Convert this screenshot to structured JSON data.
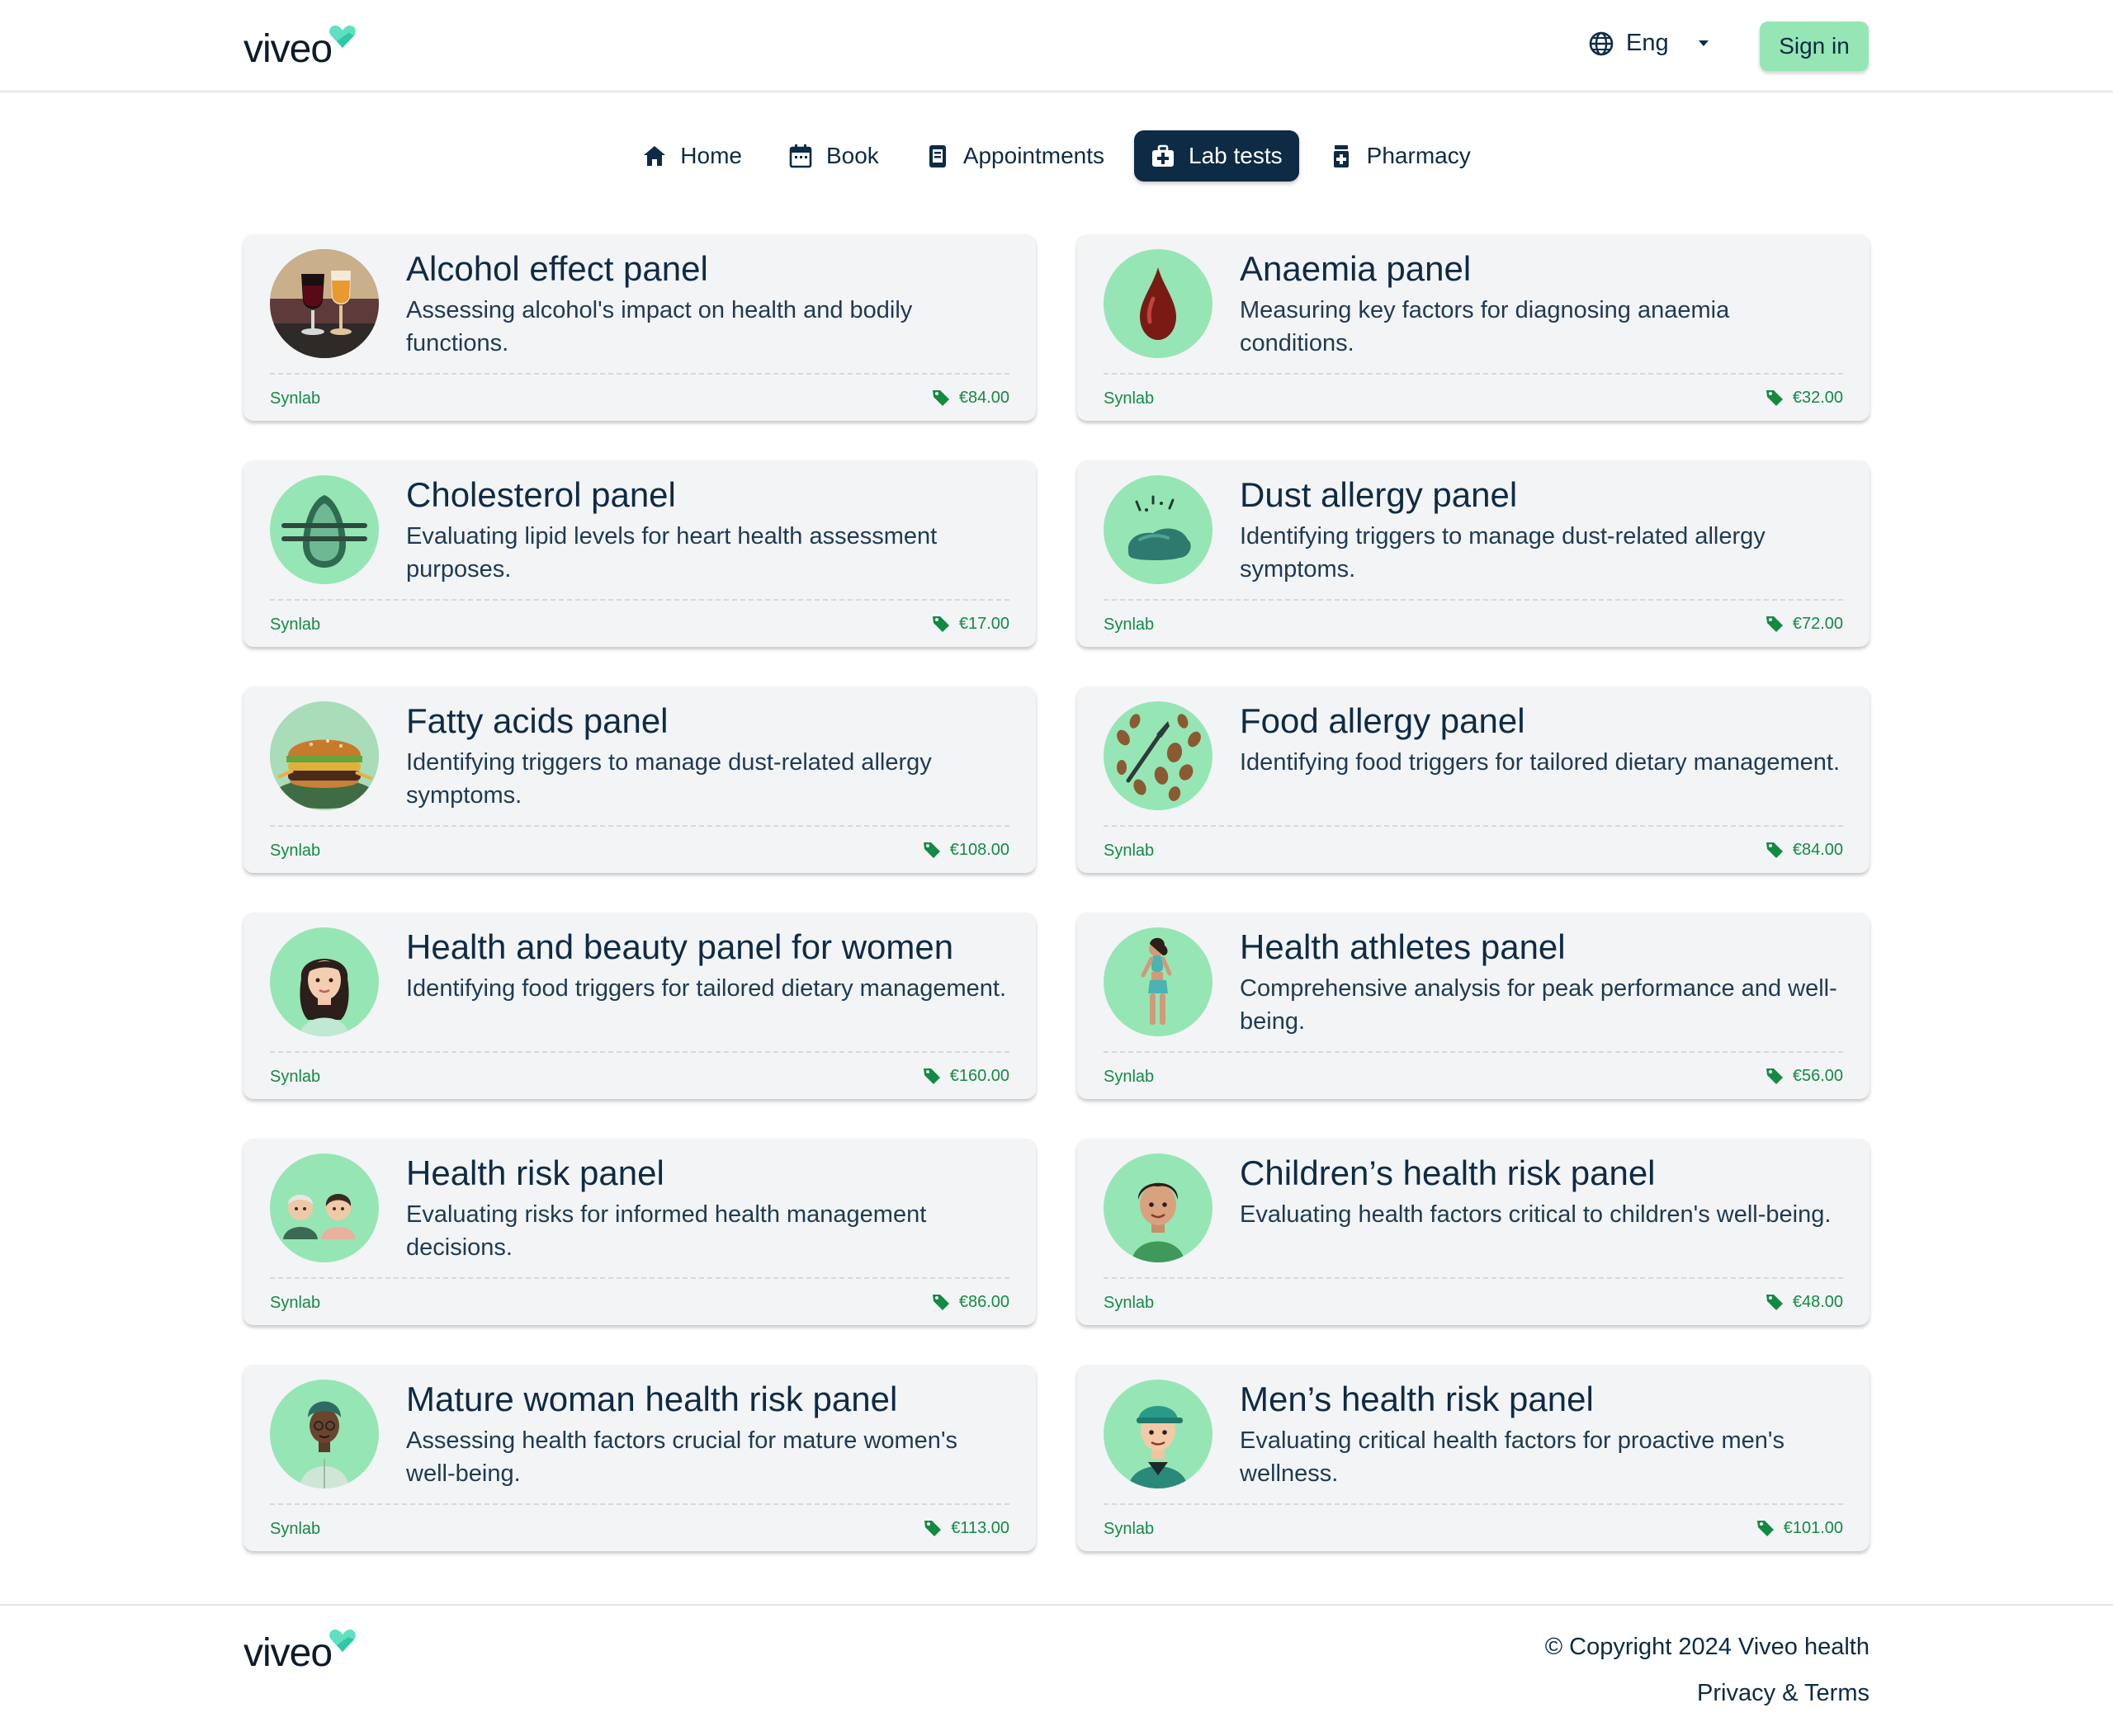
{
  "brand": {
    "name": "viveo",
    "accent": "#95e6b4",
    "navy": "#0e2b45",
    "green": "#138a44"
  },
  "header": {
    "language": "Eng",
    "sign_in": "Sign in"
  },
  "nav": {
    "items": [
      {
        "label": "Home",
        "icon": "home-icon"
      },
      {
        "label": "Book",
        "icon": "calendar-icon"
      },
      {
        "label": "Appointments",
        "icon": "clipboard-icon"
      },
      {
        "label": "Lab tests",
        "icon": "medical-kit-icon",
        "active": true
      },
      {
        "label": "Pharmacy",
        "icon": "pill-bottle-icon"
      }
    ]
  },
  "cards": [
    {
      "title": "Alcohol effect panel",
      "description": "Assessing alcohol's impact on health and bodily functions.",
      "provider": "Synlab",
      "price": "€84.00",
      "image": "wine-glasses-image"
    },
    {
      "title": "Anaemia panel",
      "description": "Measuring key factors for diagnosing anaemia conditions.",
      "provider": "Synlab",
      "price": "€32.00",
      "image": "blood-drop-image"
    },
    {
      "title": "Cholesterol panel",
      "description": "Evaluating lipid levels for heart health assessment purposes.",
      "provider": "Synlab",
      "price": "€17.00",
      "image": "avocado-image"
    },
    {
      "title": "Dust allergy panel",
      "description": "Identifying triggers to manage dust-related allergy symptoms.",
      "provider": "Synlab",
      "price": "€72.00",
      "image": "dust-pile-image"
    },
    {
      "title": "Fatty acids panel",
      "description": "Identifying triggers to manage dust-related allergy symptoms.",
      "provider": "Synlab",
      "price": "€108.00",
      "image": "burger-image"
    },
    {
      "title": "Food allergy panel",
      "description": "Identifying food triggers for tailored dietary management.",
      "provider": "Synlab",
      "price": "€84.00",
      "image": "nuts-image"
    },
    {
      "title": "Health and beauty panel for women",
      "description": "Identifying food triggers for tailored dietary management.",
      "provider": "Synlab",
      "price": "€160.00",
      "image": "woman-image"
    },
    {
      "title": "Health athletes panel",
      "description": "Comprehensive analysis for peak performance and well-being.",
      "provider": "Synlab",
      "price": "€56.00",
      "image": "athlete-image"
    },
    {
      "title": "Health risk panel",
      "description": "Evaluating risks for informed health management decisions.",
      "provider": "Synlab",
      "price": "€86.00",
      "image": "couple-image"
    },
    {
      "title": "Children’s health risk panel",
      "description": "Evaluating health factors critical to children's well-being.",
      "provider": "Synlab",
      "price": "€48.00",
      "image": "child-image"
    },
    {
      "title": "Mature woman health risk panel",
      "description": "Assessing health factors crucial for mature women's well-being.",
      "provider": "Synlab",
      "price": "€113.00",
      "image": "mature-woman-image"
    },
    {
      "title": "Men’s health risk panel",
      "description": "Evaluating critical health factors for proactive men's wellness.",
      "provider": "Synlab",
      "price": "€101.00",
      "image": "man-cap-image"
    }
  ],
  "footer": {
    "copyright": "© Copyright 2024 Viveo health",
    "terms": "Privacy & Terms"
  }
}
